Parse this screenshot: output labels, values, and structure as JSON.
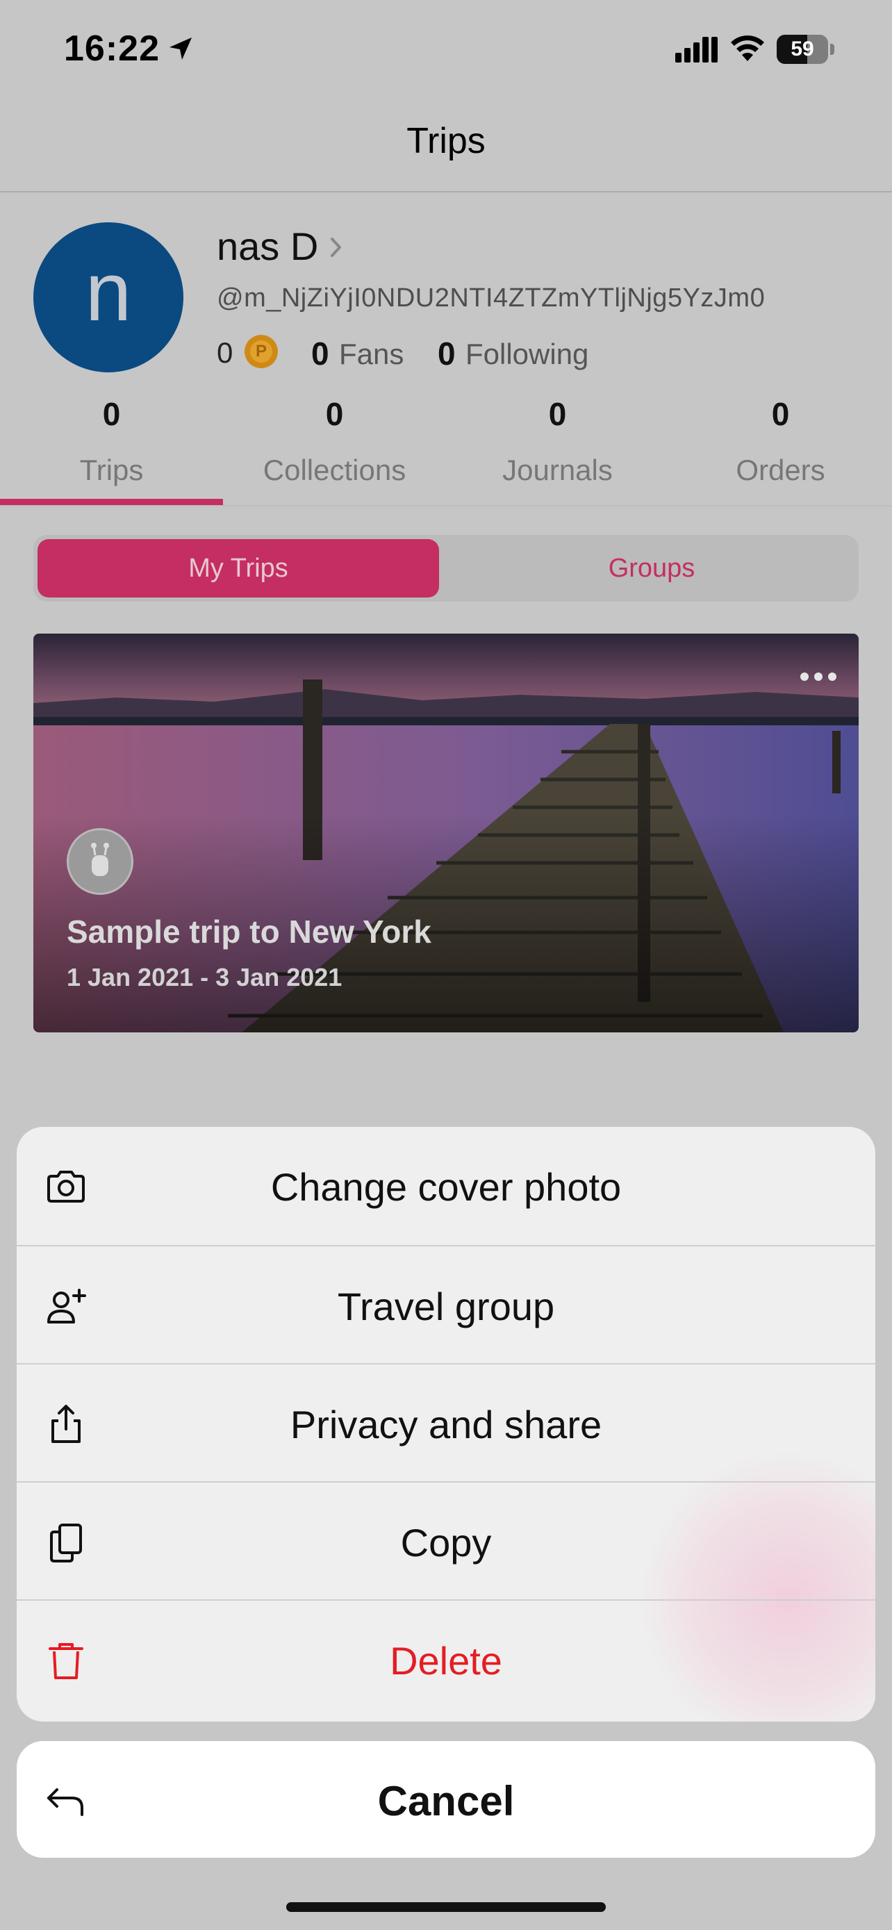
{
  "status_bar": {
    "time": "16:22",
    "battery": "59",
    "battery_level": 0.59
  },
  "nav": {
    "title": "Trips"
  },
  "profile": {
    "avatar_letter": "n",
    "name": "nas D",
    "handle": "@m_NjZiYjI0NDU2NTI4ZTZmYTljNjg5YzJm0",
    "coins": "0",
    "coin_symbol": "P",
    "fans_count": "0",
    "fans_label": "Fans",
    "following_count": "0",
    "following_label": "Following"
  },
  "tabs": [
    {
      "count": "0",
      "label": "Trips",
      "active": true
    },
    {
      "count": "0",
      "label": "Collections",
      "active": false
    },
    {
      "count": "0",
      "label": "Journals",
      "active": false
    },
    {
      "count": "0",
      "label": "Orders",
      "active": false
    }
  ],
  "segment": {
    "active": "My Trips",
    "inactive": "Groups"
  },
  "trip": {
    "title": "Sample trip to New York",
    "dates": "1 Jan 2021 - 3 Jan 2021"
  },
  "action_sheet": {
    "items": [
      {
        "label": "Change cover photo",
        "icon": "camera-icon"
      },
      {
        "label": "Travel group",
        "icon": "add-person-icon"
      },
      {
        "label": "Privacy and share",
        "icon": "share-icon"
      },
      {
        "label": "Copy",
        "icon": "copy-icon"
      },
      {
        "label": "Delete",
        "icon": "trash-icon"
      }
    ],
    "cancel": {
      "label": "Cancel",
      "icon": "undo-arrow-icon"
    }
  },
  "colors": {
    "accent": "#c42e62",
    "danger": "#e51c23",
    "avatar_bg": "#0a4a80"
  }
}
